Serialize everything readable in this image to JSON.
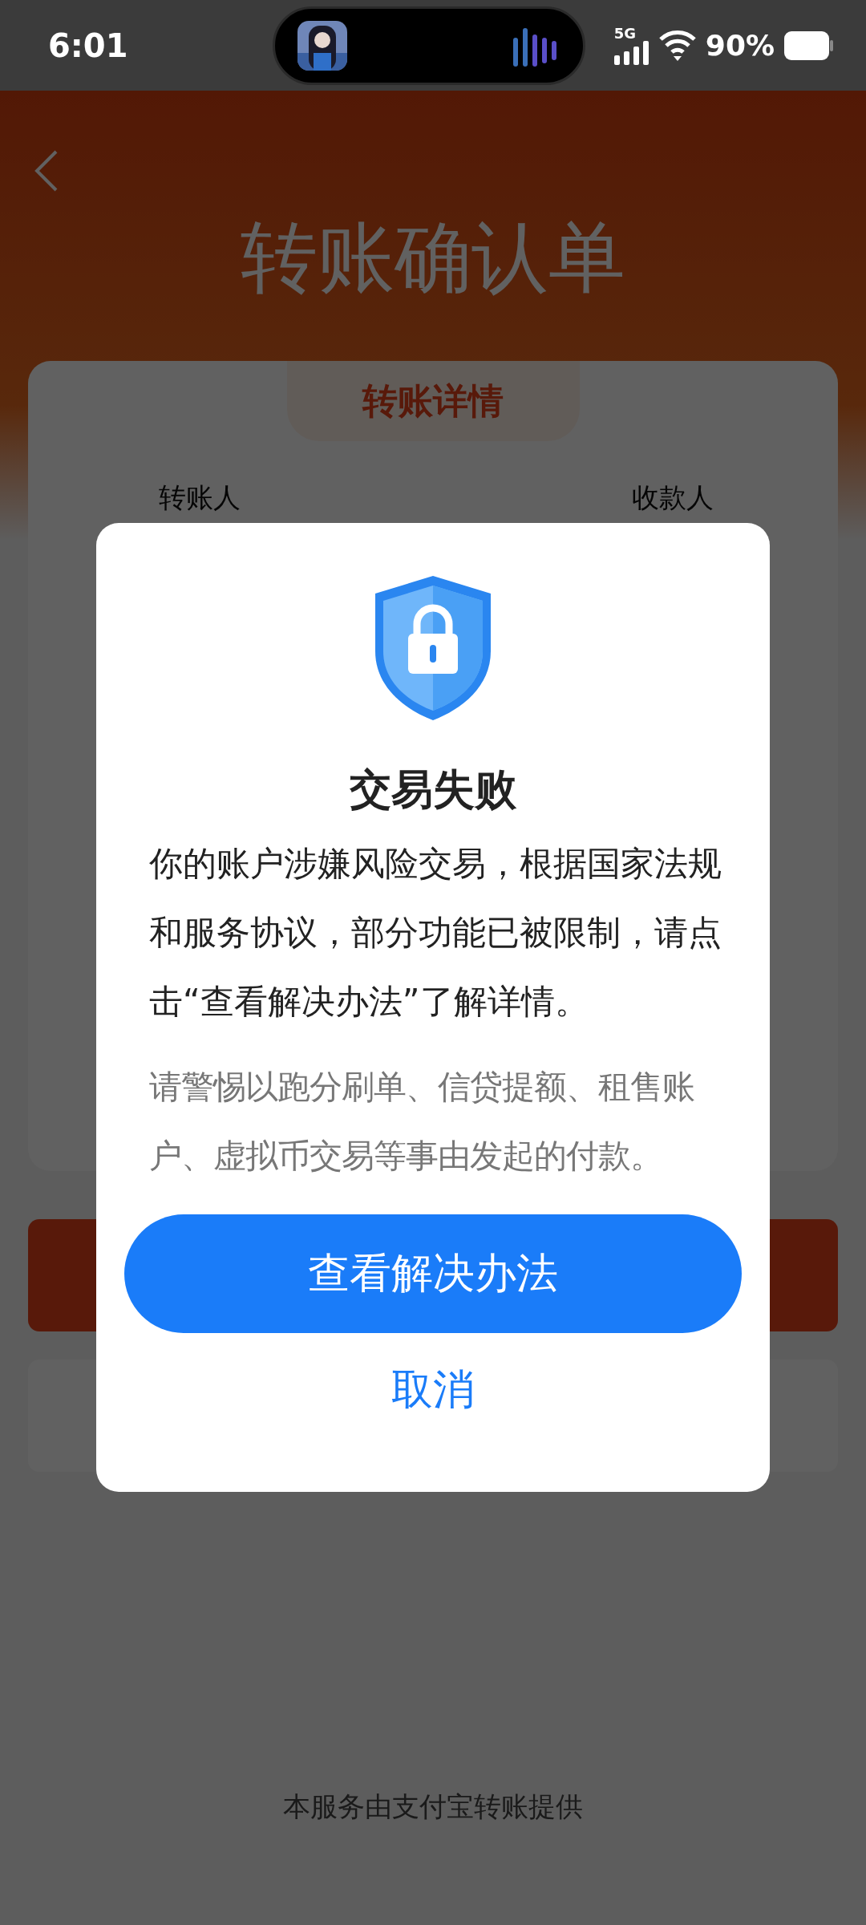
{
  "status_bar": {
    "time": "6:01",
    "network": "5G",
    "battery": "90%"
  },
  "header": {
    "title": "转账确认单"
  },
  "details_card": {
    "tab": "转账详情",
    "sender_label": "转账人",
    "recipient_label": "收款人"
  },
  "footer": "本服务由支付宝转账提供",
  "dialog": {
    "title": "交易失败",
    "message": "你的账户涉嫌风险交易，根据国家法规和服务协议，部分功能已被限制，请点击“查看解决办法”了解详情。",
    "warning": "请警惕以跑分刷单、信贷提额、租售账户、虚拟币交易等事由发起的付款。",
    "primary_button": "查看解决办法",
    "cancel_button": "取消"
  }
}
